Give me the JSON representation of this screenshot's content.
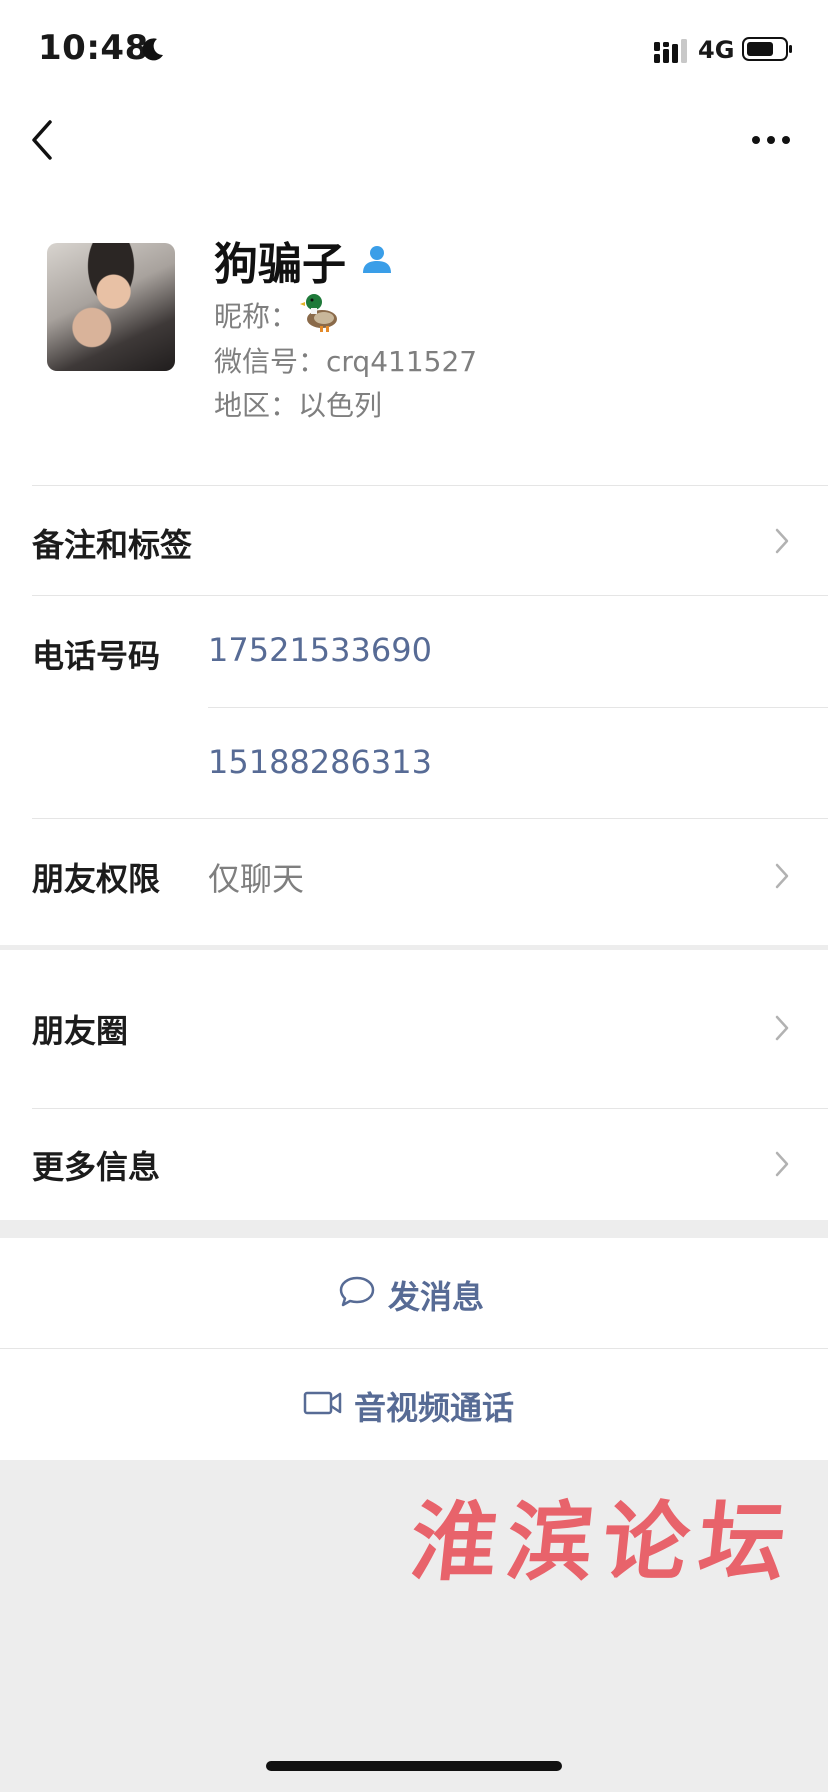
{
  "status": {
    "time": "10:48",
    "network": "4G",
    "icons": [
      "moon-icon",
      "signal-icon",
      "battery-icon"
    ]
  },
  "nav": {
    "icons": [
      "back-icon",
      "more-icon"
    ]
  },
  "profile": {
    "name": "狗骗子",
    "nickname_label": "昵称：",
    "nickname_emoji": "duck-emoji",
    "wechat_id": "微信号：crq411527",
    "region": "地区：以色列"
  },
  "rows": {
    "notes_tags": "备注和标签",
    "phone_label": "电话号码",
    "phone_1": "17521533690",
    "phone_2": "15188286313",
    "permission_label": "朋友权限",
    "permission_value": "仅聊天",
    "moments": "朋友圈",
    "more_info": "更多信息"
  },
  "actions": {
    "message": "发消息",
    "call": "音视频通话"
  },
  "watermark": "淮滨论坛",
  "colors": {
    "link": "#576b95",
    "background": "#ededed",
    "card": "#ffffff",
    "watermark": "#e8555d"
  }
}
